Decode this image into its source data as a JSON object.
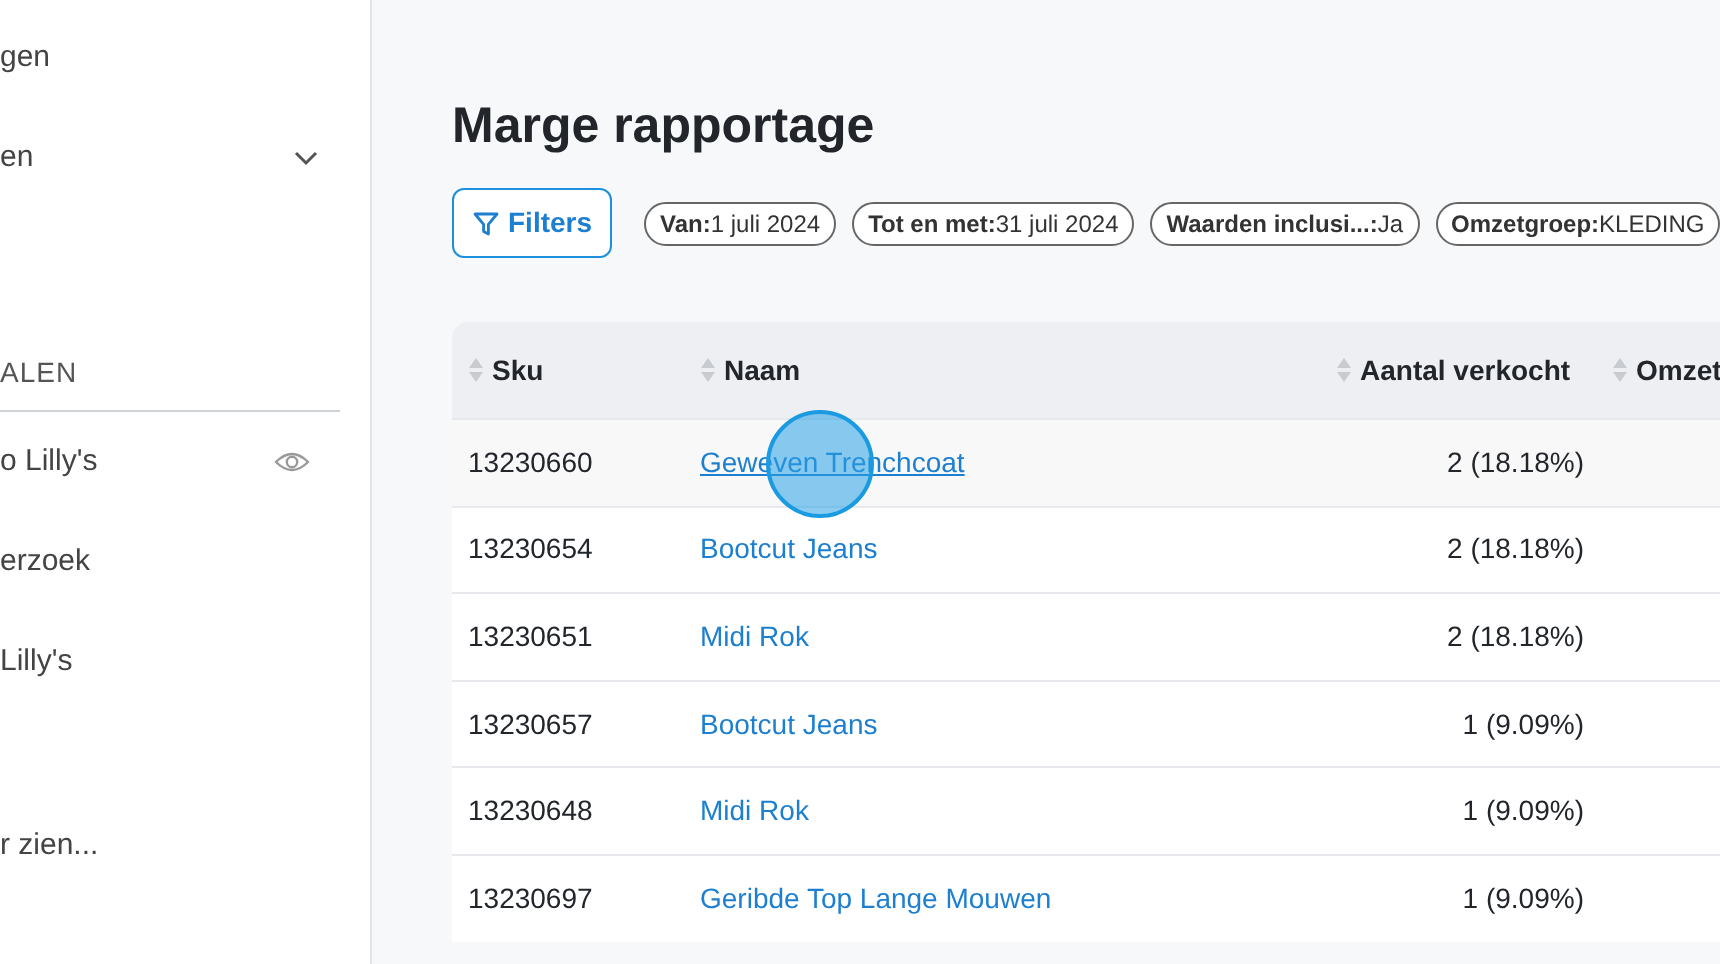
{
  "sidebar": {
    "items": [
      {
        "label": "gen",
        "kind": "link"
      },
      {
        "label": "en",
        "kind": "expandable",
        "expanded": false
      },
      {
        "label": "ALEN",
        "kind": "section"
      },
      {
        "label": "o Lilly's",
        "kind": "view"
      },
      {
        "label": "erzoek",
        "kind": "link"
      },
      {
        "label": "Lilly's",
        "kind": "link"
      },
      {
        "label": "r zien...",
        "kind": "more"
      }
    ]
  },
  "page": {
    "title": "Marge rapportage",
    "filters_button": "Filters",
    "chips": [
      {
        "key": "Van:",
        "value": "1 juli 2024"
      },
      {
        "key": "Tot en met:",
        "value": "31 juli 2024"
      },
      {
        "key": "Waarden inclusi...:",
        "value": "Ja"
      },
      {
        "key": "Omzetgroep:",
        "value": "KLEDING"
      }
    ]
  },
  "table": {
    "columns": [
      "Sku",
      "Naam",
      "Aantal verkocht",
      "Omzet"
    ],
    "rows": [
      {
        "sku": "13230660",
        "name": "Geweven Trenchcoat",
        "sold": "2 (18.18%)",
        "hovered": true
      },
      {
        "sku": "13230654",
        "name": "Bootcut Jeans",
        "sold": "2 (18.18%)",
        "hovered": false
      },
      {
        "sku": "13230651",
        "name": "Midi Rok",
        "sold": "2 (18.18%)",
        "hovered": false
      },
      {
        "sku": "13230657",
        "name": "Bootcut Jeans",
        "sold": "1 (9.09%)",
        "hovered": false
      },
      {
        "sku": "13230648",
        "name": "Midi Rok",
        "sold": "1 (9.09%)",
        "hovered": false
      },
      {
        "sku": "13230697",
        "name": "Geribde Top Lange Mouwen",
        "sold": "1 (9.09%)",
        "hovered": false
      }
    ]
  }
}
